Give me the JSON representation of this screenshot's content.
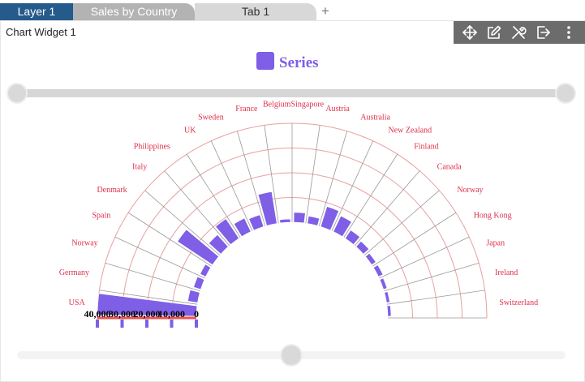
{
  "tabs": [
    {
      "label": "Layer 1"
    },
    {
      "label": "Sales by Country"
    },
    {
      "label": "Tab 1"
    }
  ],
  "add_tab_label": "+",
  "widget": {
    "title": "Chart Widget 1",
    "toolbar": [
      {
        "icon": "move-icon"
      },
      {
        "icon": "edit-icon"
      },
      {
        "icon": "settings-icon"
      },
      {
        "icon": "export-icon"
      },
      {
        "icon": "more-icon"
      }
    ]
  },
  "colors": {
    "series": "#7e5fe6",
    "label": "#e0314d",
    "radial_line": "#999999",
    "ring": "#e8a0a0",
    "slider_track": "#d6d6d6",
    "slider_handle": "#d9d9d9",
    "tab_active": "#255a8c"
  },
  "chart_data": {
    "type": "bar",
    "polar": true,
    "legend": {
      "placement": "top-center",
      "entries": [
        {
          "name": "Series"
        }
      ]
    },
    "categories": [
      "USA",
      "Germany",
      "Norway",
      "Spain",
      "Denmark",
      "Italy",
      "Philippines",
      "UK",
      "Sweden",
      "France",
      "Belgium",
      "Singapore",
      "Austria",
      "Australia",
      "New Zealand",
      "Finland",
      "Canada",
      "Norway",
      "Hong Kong",
      "Japan",
      "Ireland",
      "Switzerland"
    ],
    "series": [
      {
        "name": "Series",
        "values": [
          40000,
          4000,
          3000,
          2500,
          17000,
          6500,
          9500,
          6000,
          5000,
          13000,
          0,
          4000,
          3000,
          8500,
          7000,
          4000,
          3000,
          2000,
          2000,
          1500,
          800,
          600
        ]
      }
    ],
    "axis": {
      "min": 0,
      "max": 40000,
      "ticks": [
        "40,000",
        "30,000",
        "20,000",
        "10,000",
        "0"
      ]
    },
    "sliders": {
      "top": [
        0,
        1
      ],
      "bottom": [
        0.5
      ]
    }
  }
}
